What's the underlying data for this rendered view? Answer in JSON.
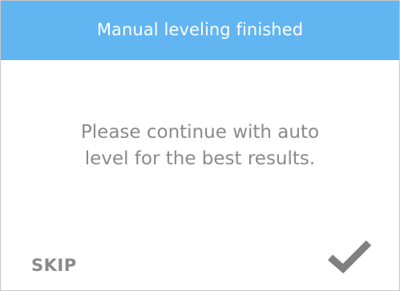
{
  "dialog": {
    "title": "Manual leveling finished",
    "message_line_1": "Please continue with auto",
    "message_line_2": "level for the best results.",
    "skip_label": "SKIP",
    "confirm_icon": "checkmark-icon"
  },
  "colors": {
    "header_background": "#61b5f0",
    "header_text": "#ffffff",
    "body_text": "#8a8a8a",
    "icon": "#808080"
  }
}
